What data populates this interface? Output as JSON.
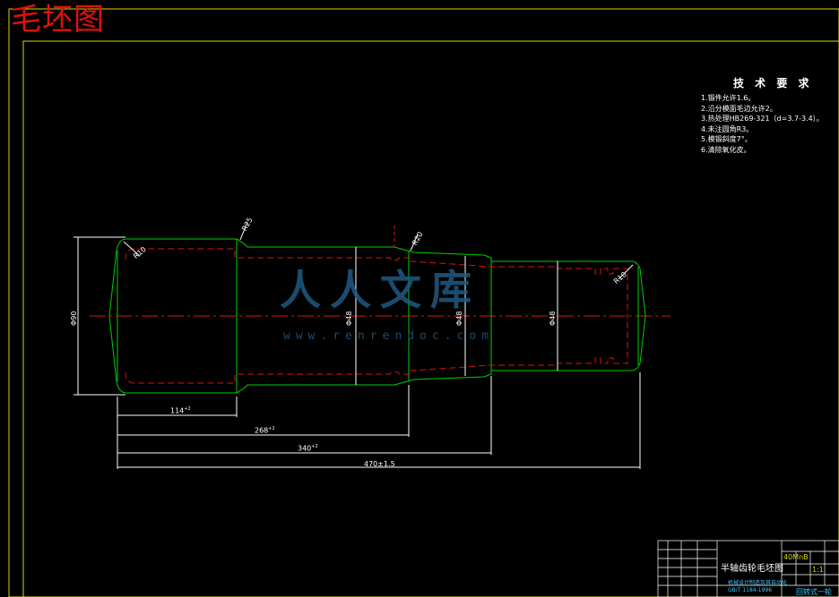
{
  "stamp_text": "毛坯图",
  "tech_requirements": {
    "title": "技 术 要 求",
    "items": [
      "1.锻件允许1.6。",
      "2.沿分模面毛边允许2。",
      "3.热处理HB269-321（d=3.7-3.4）。",
      "4.未注圆角R3。",
      "5.模锻斜度7°。",
      "6.清除氧化皮。"
    ]
  },
  "watermark": {
    "mark": "人人文库",
    "url": "www.renrendoc.com"
  },
  "dimensions": {
    "len_114": "114",
    "len_114_tol": "+2",
    "len_268": "268",
    "len_268_tol": "+2",
    "len_340": "340",
    "len_340_tol": "+2",
    "len_470": "470±1.5",
    "dia_1": "Φ90",
    "dia_2": "Φ48",
    "dia_3": "Φ48",
    "dia_4": "Φ48",
    "radius_r10": "R10",
    "radius_r25": "R25",
    "radius_r20": "R20",
    "radius_r10b": "R10"
  },
  "title_block": {
    "drawing_name": "半轴齿轮毛坯图",
    "material": "40MnB",
    "scale": "1:1",
    "school_line": "机械设计制造及其自动化",
    "code_line": "GB/T 1184-1996",
    "footer": "回转式一轮"
  },
  "colors": {
    "outline": "#00d000",
    "hidden": "#e01010",
    "frame": "#d8d800",
    "dim": "#ffffff",
    "watermark": "#1f5a82"
  }
}
